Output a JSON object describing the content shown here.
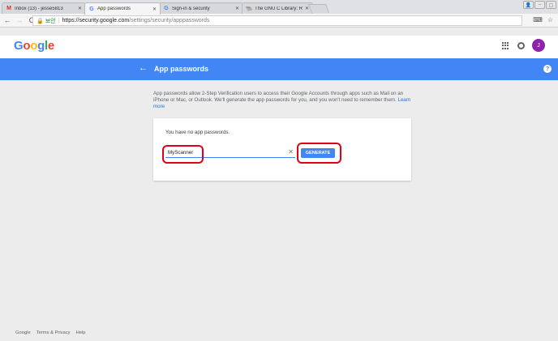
{
  "browser": {
    "tabs": [
      {
        "title": "Inbox (13) - jesse5813",
        "favicon": "gmail-icon",
        "active": false
      },
      {
        "title": "App passwords",
        "favicon": "google-icon",
        "active": true
      },
      {
        "title": "Sign-in & security",
        "favicon": "google-icon",
        "active": false
      },
      {
        "title": "The GNU C Library: Re",
        "favicon": "gnu-icon",
        "active": false
      }
    ],
    "address": {
      "secure_label": "보안",
      "url_host": "https://security.google.com",
      "url_path": "/settings/security/apppasswords"
    }
  },
  "header": {
    "logo": "Google",
    "avatar_letter": "J",
    "avatar_color": "#8e24aa"
  },
  "appbar": {
    "title": "App passwords",
    "color": "#4285f4"
  },
  "main": {
    "description": "App passwords allow 2-Step Verification users to access their Google Accounts through apps such as Mail on an iPhone or Mac, or Outlook. We'll generate the app passwords for you, and you won't need to remember them.",
    "learn_more": "Learn more",
    "empty_message": "You have no app passwords.",
    "app_name_value": "MyScanner",
    "generate_label": "GENERATE"
  },
  "footer": {
    "links": [
      "Google",
      "Terms & Privacy",
      "Help"
    ]
  }
}
